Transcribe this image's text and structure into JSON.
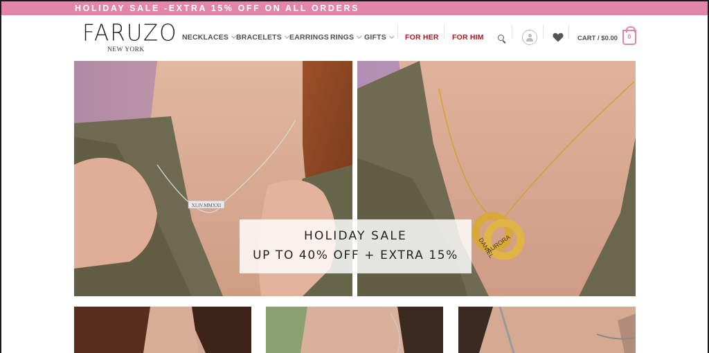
{
  "announcement": {
    "text": "HOLIDAY SALE -EXTRA 15% OFF ON ALL ORDERS"
  },
  "brand": {
    "logo_text": "FARUZO",
    "logo_subtext": "NEW YORK"
  },
  "nav": {
    "items": [
      {
        "label": "NECKLACES",
        "has_dropdown": true
      },
      {
        "label": "BRACELETS",
        "has_dropdown": true
      },
      {
        "label": "EARRINGS",
        "has_dropdown": false
      },
      {
        "label": "RINGS",
        "has_dropdown": true
      },
      {
        "label": "GIFTS",
        "has_dropdown": true
      }
    ],
    "highlight_items": [
      {
        "label": "FOR HER"
      },
      {
        "label": "FOR HIM"
      }
    ]
  },
  "header_icons": [
    "search-icon",
    "account-icon",
    "heart-icon",
    "cart-icon"
  ],
  "cart": {
    "label": "CART / $0.00",
    "count": "0"
  },
  "hero": {
    "left_necklace_engraving": "XLIV.MMXXI",
    "right_necklace_engraving_1": "DANIEL",
    "right_necklace_engraving_2": "AURORA",
    "overlay_line1": "HOLIDAY SALE",
    "overlay_line2": "UP TO 40% OFF + EXTRA 15%"
  },
  "colors": {
    "accent_pink": "#e285a9",
    "highlight_red": "#b3141c",
    "nav_text": "#4d4d4d"
  }
}
